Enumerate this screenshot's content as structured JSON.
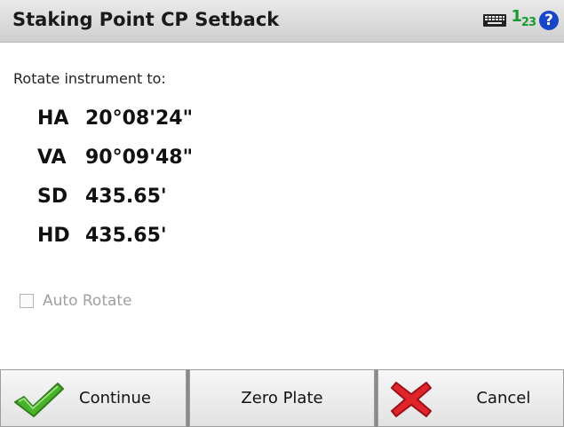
{
  "window": {
    "title": "Staking Point CP Setback"
  },
  "titlebar_icons": [
    "keyboard-icon",
    "numeric-input-icon",
    "help-icon"
  ],
  "numeric_icon": {
    "a": "1",
    "b": "2",
    "c": "3"
  },
  "help_label": "?",
  "instruction": "Rotate instrument to:",
  "readouts": [
    {
      "label": "HA",
      "value": "20°08'24\""
    },
    {
      "label": "VA",
      "value": "90°09'48\""
    },
    {
      "label": "SD",
      "value": "435.65'"
    },
    {
      "label": "HD",
      "value": "435.65'"
    }
  ],
  "auto_rotate": {
    "label": "Auto Rotate",
    "checked": false,
    "enabled": false
  },
  "buttons": {
    "continue": "Continue",
    "zero_plate": "Zero Plate",
    "cancel": "Cancel"
  },
  "colors": {
    "title_bar": "#d9d9d9",
    "check_green": "#48b22a",
    "cancel_red": "#e0242c",
    "help_blue": "#1747c8",
    "numeric_green": "#1a9a2e"
  }
}
